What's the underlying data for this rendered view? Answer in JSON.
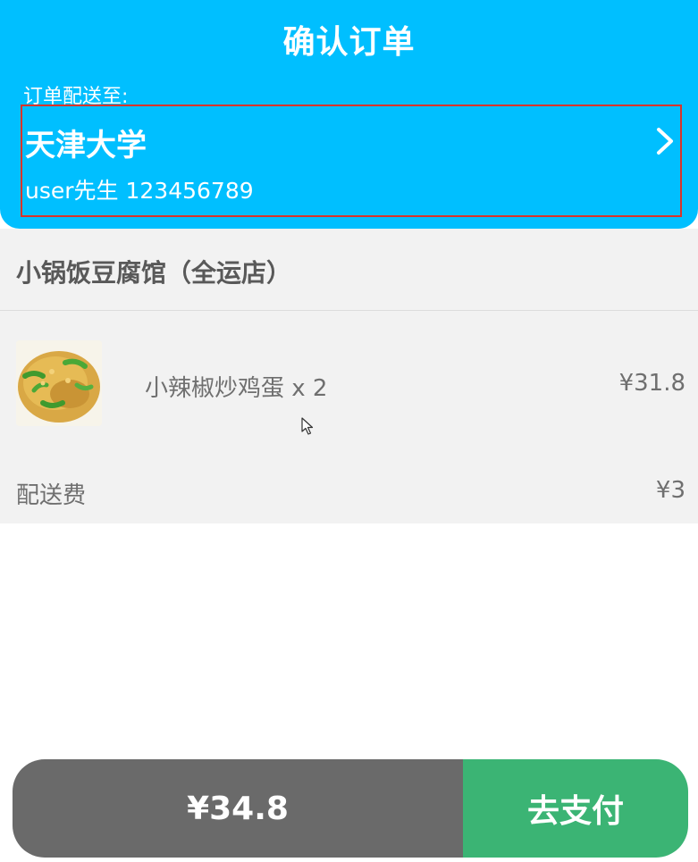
{
  "header": {
    "title": "确认订单",
    "deliver_to_label": "订单配送至:",
    "address": {
      "name": "天津大学",
      "contact": "user先生 123456789"
    },
    "chevron_icon": "chevron-right-icon"
  },
  "order": {
    "shop_name": "小锅饭豆腐馆（全运店）",
    "items": [
      {
        "name": "小辣椒炒鸡蛋 x 2",
        "price": "¥31.8",
        "image_icon": "dish-photo"
      }
    ],
    "delivery_fee_label": "配送费",
    "delivery_fee_value": "¥3"
  },
  "footer": {
    "total": "¥34.8",
    "pay_label": "去支付"
  },
  "colors": {
    "header_bg": "#00bfff",
    "highlight_border": "#d9342b",
    "card_bg": "#f2f2f2",
    "total_bg": "#6a6a6a",
    "pay_bg": "#3bb474"
  }
}
